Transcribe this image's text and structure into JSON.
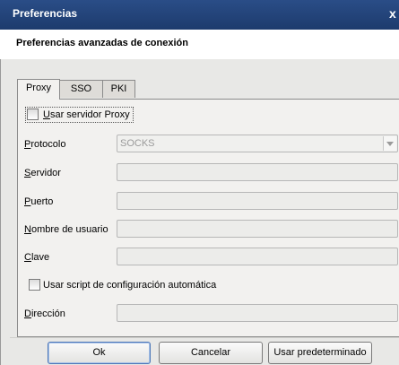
{
  "window": {
    "title": "Preferencias",
    "close_glyph": "x"
  },
  "header": {
    "title": "Preferencias avanzadas de conexión"
  },
  "tabs": [
    {
      "label": "Proxy",
      "active": true
    },
    {
      "label": "SSO",
      "active": false
    },
    {
      "label": "PKI",
      "active": false
    }
  ],
  "proxy": {
    "use_proxy": {
      "label": "Usar servidor Proxy",
      "checked": false
    },
    "protocol": {
      "label": "Protocolo",
      "value": "SOCKS"
    },
    "server": {
      "label": "Servidor",
      "value": ""
    },
    "port": {
      "label": "Puerto",
      "value": ""
    },
    "username": {
      "label": "Nombre de usuario",
      "value": ""
    },
    "password": {
      "label": "Clave",
      "value": ""
    },
    "auto_config": {
      "label": "Usar script de configuración automática",
      "checked": false
    },
    "address": {
      "label": "Dirección",
      "value": ""
    }
  },
  "buttons": {
    "ok": "Ok",
    "cancel": "Cancelar",
    "defaults": "Usar predeterminado"
  },
  "colors": {
    "titlebar": "#1d3b6d",
    "dialog_bg": "#e8e8e6",
    "default_button_border": "#4d77b8"
  }
}
